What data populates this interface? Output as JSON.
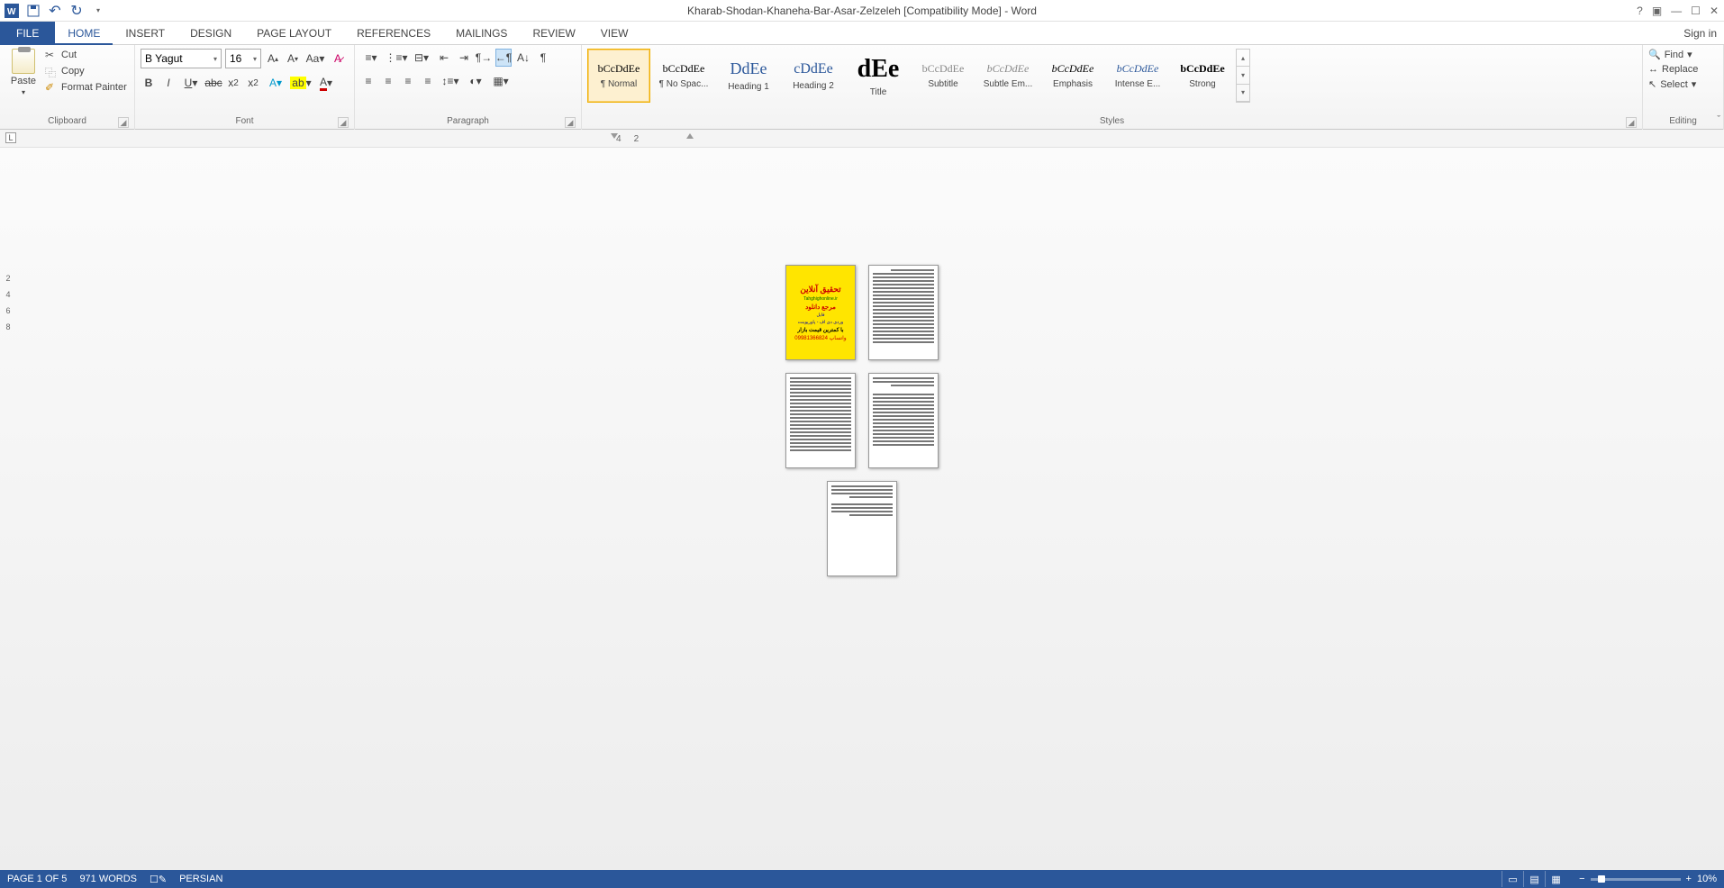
{
  "title": "Kharab-Shodan-Khaneha-Bar-Asar-Zelzeleh [Compatibility Mode] - Word",
  "signin": "Sign in",
  "tabs": [
    "FILE",
    "HOME",
    "INSERT",
    "DESIGN",
    "PAGE LAYOUT",
    "REFERENCES",
    "MAILINGS",
    "REVIEW",
    "VIEW"
  ],
  "active_tab": "HOME",
  "clipboard": {
    "paste": "Paste",
    "cut": "Cut",
    "copy": "Copy",
    "fmt": "Format Painter",
    "label": "Clipboard"
  },
  "font": {
    "name": "B Yagut",
    "size": "16",
    "label": "Font"
  },
  "paragraph": {
    "label": "Paragraph"
  },
  "styles": {
    "label": "Styles",
    "items": [
      {
        "preview": "bCcDdEe",
        "name": "¶ Normal"
      },
      {
        "preview": "bCcDdEe",
        "name": "¶ No Spac..."
      },
      {
        "preview": "DdEe",
        "name": "Heading 1"
      },
      {
        "preview": "cDdEe",
        "name": "Heading 2"
      },
      {
        "preview": "dEe",
        "name": "Title"
      },
      {
        "preview": "bCcDdEe",
        "name": "Subtitle"
      },
      {
        "preview": "bCcDdEe",
        "name": "Subtle Em..."
      },
      {
        "preview": "bCcDdEe",
        "name": "Emphasis"
      },
      {
        "preview": "bCcDdEe",
        "name": "Intense E..."
      },
      {
        "preview": "bCcDdEe",
        "name": "Strong"
      }
    ]
  },
  "editing": {
    "find": "Find",
    "replace": "Replace",
    "select": "Select",
    "label": "Editing"
  },
  "ruler": {
    "h1": "4",
    "h2": "2",
    "v": [
      "2",
      "4",
      "6",
      "8"
    ]
  },
  "cover": {
    "l1": "تحقیق آنلاین",
    "l2": "Tahghighonline.ir",
    "l3": "مرجع دانلود",
    "l4": "فایل",
    "l5": "وردی دی اف - پاورپوینت",
    "l6": "با کمترین قیمت بازار",
    "l7": "09981366824 واتساپ"
  },
  "status": {
    "page": "PAGE 1 OF 5",
    "words": "971 WORDS",
    "lang": "PERSIAN",
    "zoom": "10%"
  }
}
